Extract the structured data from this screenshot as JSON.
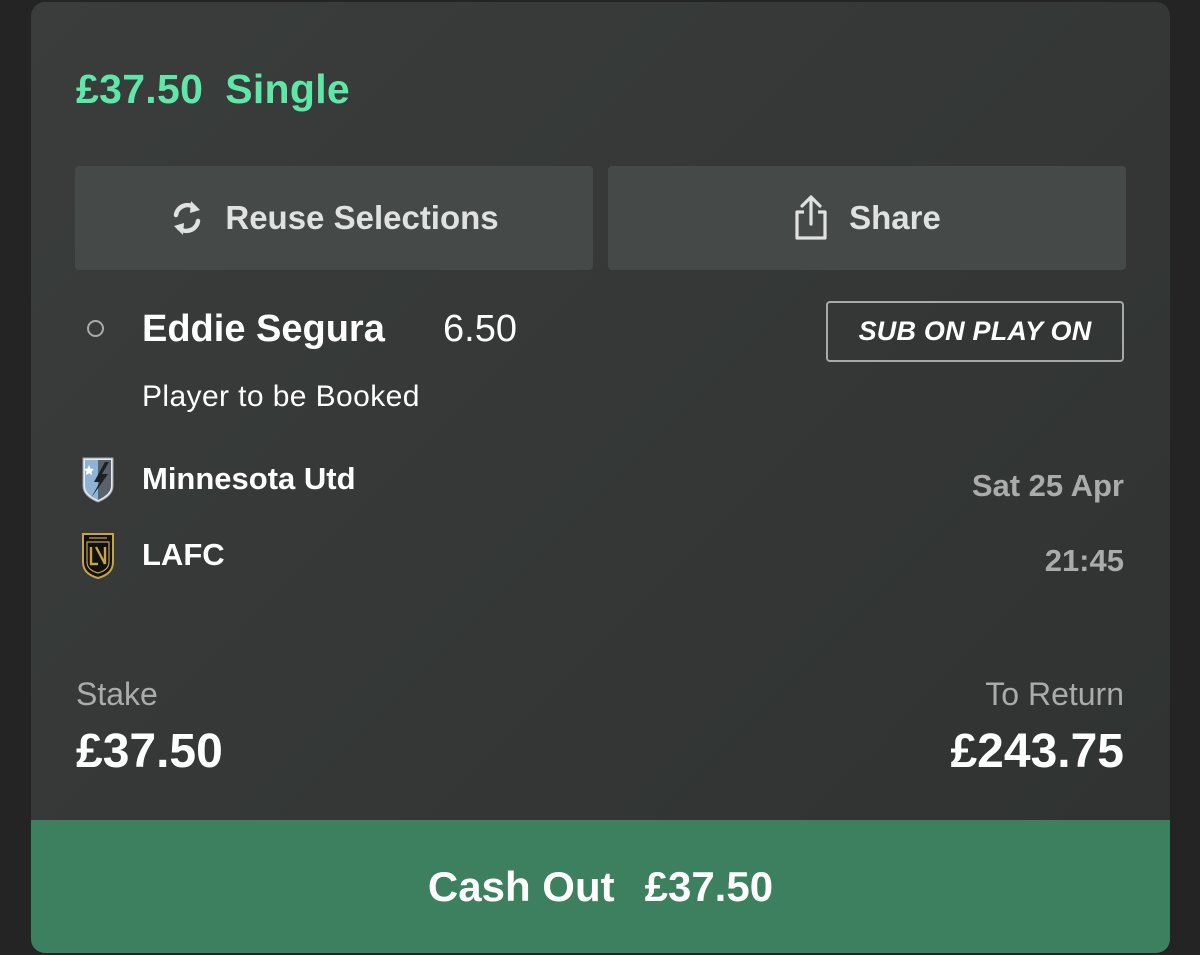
{
  "header": {
    "amount": "£37.50",
    "bet_type": "Single",
    "accent_color": "#5ee8a8"
  },
  "actions": {
    "reuse_label": "Reuse Selections",
    "reuse_icon": "refresh-icon",
    "share_label": "Share",
    "share_icon": "share-icon"
  },
  "selection": {
    "player": "Eddie Segura",
    "odds": "6.50",
    "badge": "SUB ON PLAY ON",
    "market": "Player to be Booked"
  },
  "event": {
    "home_team": "Minnesota Utd",
    "home_crest": "minnesota-united-crest",
    "away_team": "LAFC",
    "away_crest": "lafc-crest",
    "date": "Sat 25 Apr",
    "time": "21:45"
  },
  "bet": {
    "stake_label": "Stake",
    "stake_value": "£37.50",
    "return_label": "To Return",
    "return_value": "£243.75"
  },
  "cashout": {
    "label": "Cash Out",
    "amount": "£37.50",
    "color": "#3d8060"
  }
}
